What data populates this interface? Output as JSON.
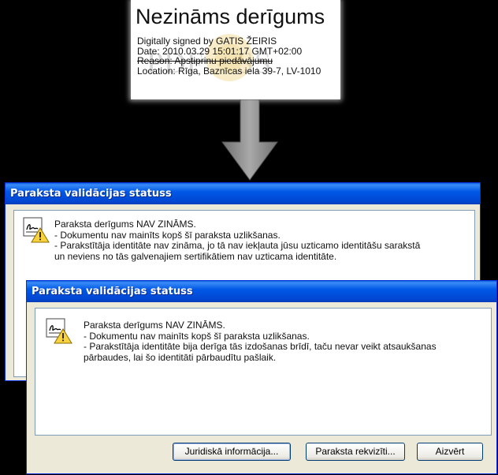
{
  "signature_stamp": {
    "title": "Nezināms derīgums",
    "lines": [
      "Digitally signed by GATIS ŽEIRIS",
      "Date: 2010.03.29 15:01:17 GMT+02:00",
      "Reason: Apstiprinu piedāvājumu",
      "Location: Rīga, Baznīcas iela 39-7, LV-1010"
    ]
  },
  "dialog_back": {
    "title": "Paraksta validācijas statuss",
    "lines": [
      "Paraksta derīgums NAV ZINĀMS.",
      "- Dokumentu nav mainīts kopš šī paraksta uzlikšanas.",
      "- Parakstītāja identitāte nav zināma, jo tā nav iekļauta jūsu uzticamo identitāšu sarakstā",
      "un neviens no tās galvenajiem sertifikātiem nav uzticama identitāte."
    ]
  },
  "dialog_front": {
    "title": "Paraksta validācijas statuss",
    "lines": [
      "Paraksta derīgums NAV ZINĀMS.",
      "- Dokumentu nav mainīts kopš šī paraksta uzlikšanas.",
      "- Parakstītāja identitāte bija derīga tās izdošanas brīdī, taču nevar veikt atsaukšanas",
      "pārbaudes, lai šo identitāti pārbaudītu pašlaik."
    ],
    "buttons": {
      "legal": "Juridiskā informācija...",
      "properties": "Paraksta rekvizīti...",
      "close": "Aizvērt"
    }
  },
  "colors": {
    "titlebar_blue": "#0058e6",
    "dialog_face": "#ece9d8",
    "warning_yellow": "#f7d23e"
  },
  "icons": [
    "signature-warning-icon",
    "down-arrow-icon"
  ]
}
